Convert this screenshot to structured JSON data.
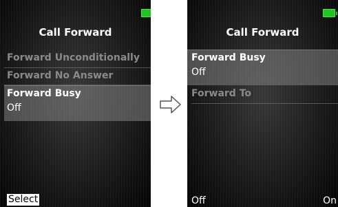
{
  "left_screen": {
    "title": "Call Forward",
    "menu_items": [
      "Forward Unconditionally",
      "Forward No Answer"
    ],
    "selected_item": {
      "label": "Forward Busy",
      "value": "Off"
    },
    "softkey_left": "Select",
    "battery_color": "#22c422"
  },
  "right_screen": {
    "title": "Call Forward",
    "selected_item": {
      "label": "Forward Busy",
      "value": "Off"
    },
    "menu_items": [
      "Forward To"
    ],
    "softkey_left": "Off",
    "softkey_right": "On",
    "battery_color": "#22c422"
  },
  "transition_icon": "right-arrow-icon"
}
